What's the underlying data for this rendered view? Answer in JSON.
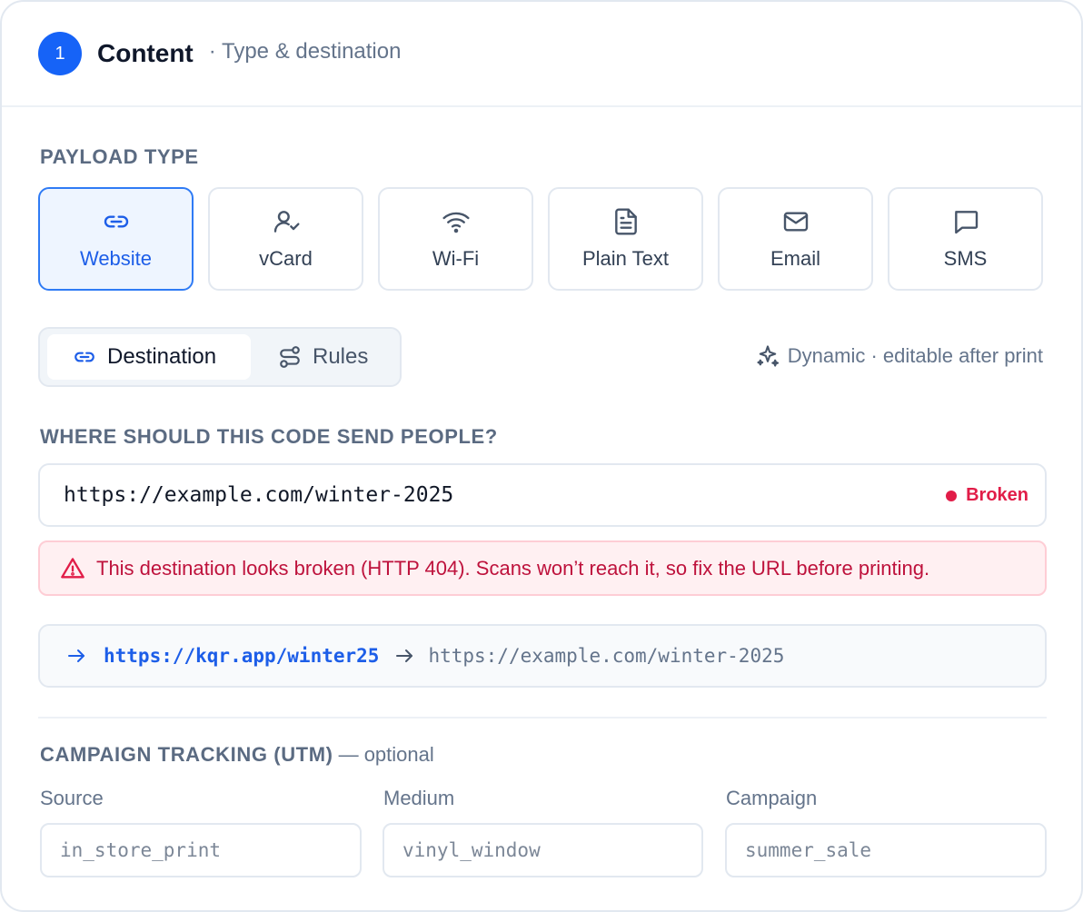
{
  "header": {
    "step_number": "1",
    "title": "Content",
    "subtitle": "· Type & destination"
  },
  "payload": {
    "label": "PAYLOAD TYPE",
    "selected": "Website",
    "types": [
      {
        "label": "Website",
        "icon": "link-icon"
      },
      {
        "label": "vCard",
        "icon": "user-check-icon"
      },
      {
        "label": "Wi-Fi",
        "icon": "wifi-icon"
      },
      {
        "label": "Plain Text",
        "icon": "document-icon"
      },
      {
        "label": "Email",
        "icon": "mail-icon"
      },
      {
        "label": "SMS",
        "icon": "message-icon"
      }
    ]
  },
  "tabs": {
    "destination": "Destination",
    "rules": "Rules",
    "active": "Destination"
  },
  "dynamic_note": "Dynamic · editable after print",
  "destination": {
    "label": "WHERE SHOULD THIS CODE SEND PEOPLE?",
    "url": "https://example.com/winter-2025",
    "status": "Broken",
    "alert": "This destination looks broken (HTTP 404). Scans won’t reach it, so fix the URL before printing."
  },
  "redirect": {
    "short_url": "https://kqr.app/winter25",
    "target_url": "https://example.com/winter-2025"
  },
  "utm": {
    "label": "CAMPAIGN TRACKING (UTM)",
    "optional": "— optional",
    "fields": [
      {
        "label": "Source",
        "placeholder": "in_store_print"
      },
      {
        "label": "Medium",
        "placeholder": "vinyl_window"
      },
      {
        "label": "Campaign",
        "placeholder": "summer_sale"
      }
    ]
  },
  "colors": {
    "accent": "#1663f7",
    "error": "#e11d48",
    "muted": "#64748b"
  }
}
